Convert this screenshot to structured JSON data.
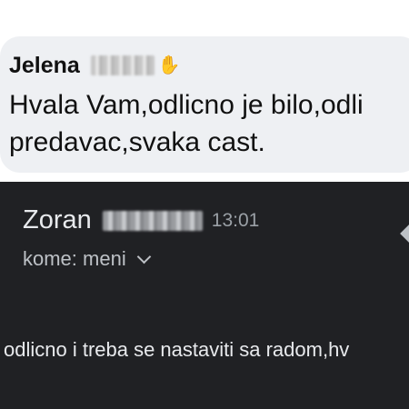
{
  "chat": {
    "sender_name": "Jelena",
    "reaction_icon": "waving-hand-icon",
    "message_line1": "Hvala Vam,odlicno je bilo,odli",
    "message_line2": "predavac,svaka cast."
  },
  "email": {
    "sender_name": "Zoran",
    "time": "13:01",
    "recipient": "kome: meni",
    "body": "odlicno i treba se nastaviti sa radom,hv"
  },
  "colors": {
    "bubble_background": "#eef0f3",
    "dark_background": "#202124",
    "dark_text": "#e8eaed",
    "muted_text": "#9aa0a6"
  }
}
